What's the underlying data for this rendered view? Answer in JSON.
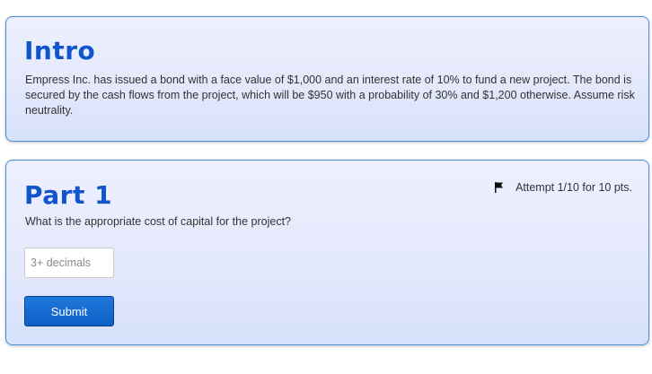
{
  "intro": {
    "title": "Intro",
    "text": "Empress Inc. has issued a bond with a face value of $1,000 and an interest rate of 10% to fund a new project. The bond is secured by the cash flows from the project, which will be $950 with a probability of 30% and $1,200 otherwise. Assume risk neutrality."
  },
  "part1": {
    "title": "Part 1",
    "attempt": "Attempt 1/10 for 10 pts.",
    "attempt_icon": "flag-icon",
    "question": "What is the appropriate cost of capital for the project?",
    "input_placeholder": "3+ decimals",
    "input_value": "",
    "submit_label": "Submit"
  },
  "colors": {
    "heading": "#1155cc",
    "card_border": "#4a90d9",
    "button": "#0d5fc4"
  }
}
